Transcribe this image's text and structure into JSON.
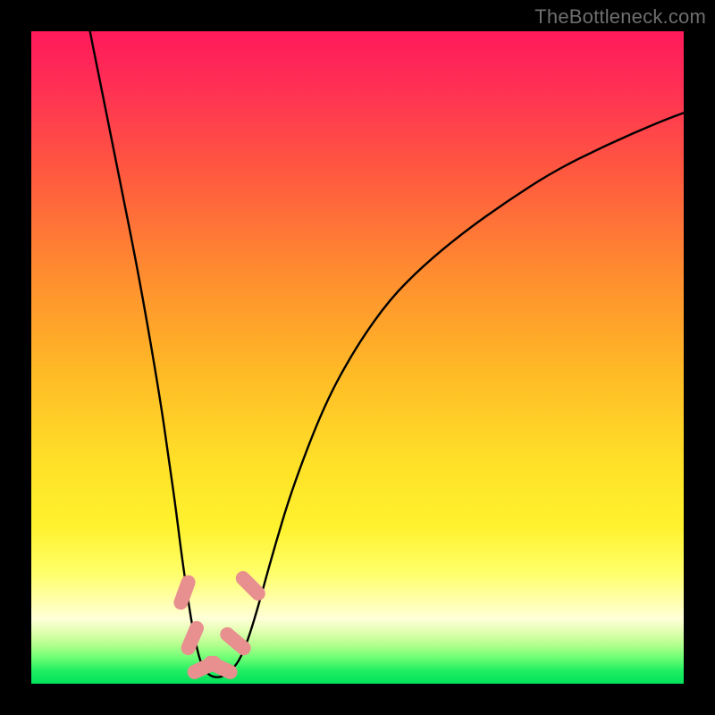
{
  "watermark": "TheBottleneck.com",
  "colors": {
    "frame": "#000000",
    "curve": "#000000",
    "marker": "#e47c7c",
    "marker_fill": "#e88f8f"
  },
  "chart_data": {
    "type": "line",
    "title": "",
    "xlabel": "",
    "ylabel": "",
    "xlim": [
      0,
      100
    ],
    "ylim": [
      0,
      100
    ],
    "series": [
      {
        "name": "bottleneck-curve",
        "x": [
          9,
          10,
          12,
          14,
          16,
          18,
          20,
          21,
          22,
          23,
          24,
          25,
          26,
          27,
          28,
          29,
          30,
          32,
          34,
          37,
          40,
          45,
          50,
          55,
          60,
          66,
          73,
          80,
          88,
          96,
          100
        ],
        "y": [
          100,
          95,
          85,
          75,
          65,
          54,
          42,
          35,
          28,
          20,
          13,
          7,
          3,
          1.5,
          1,
          1,
          1.5,
          3.5,
          9,
          20,
          30,
          43,
          52,
          59,
          64,
          69,
          74,
          78.5,
          82.5,
          86,
          87.5
        ]
      }
    ],
    "markers": [
      {
        "x": 23.5,
        "y": 14,
        "rot": 20
      },
      {
        "x": 24.7,
        "y": 7,
        "rot": 23
      },
      {
        "x": 26.5,
        "y": 2.5,
        "rot": 65
      },
      {
        "x": 29.0,
        "y": 2.5,
        "rot": 115
      },
      {
        "x": 31.3,
        "y": 6.5,
        "rot": 130
      },
      {
        "x": 33.6,
        "y": 15,
        "rot": 135
      }
    ]
  }
}
